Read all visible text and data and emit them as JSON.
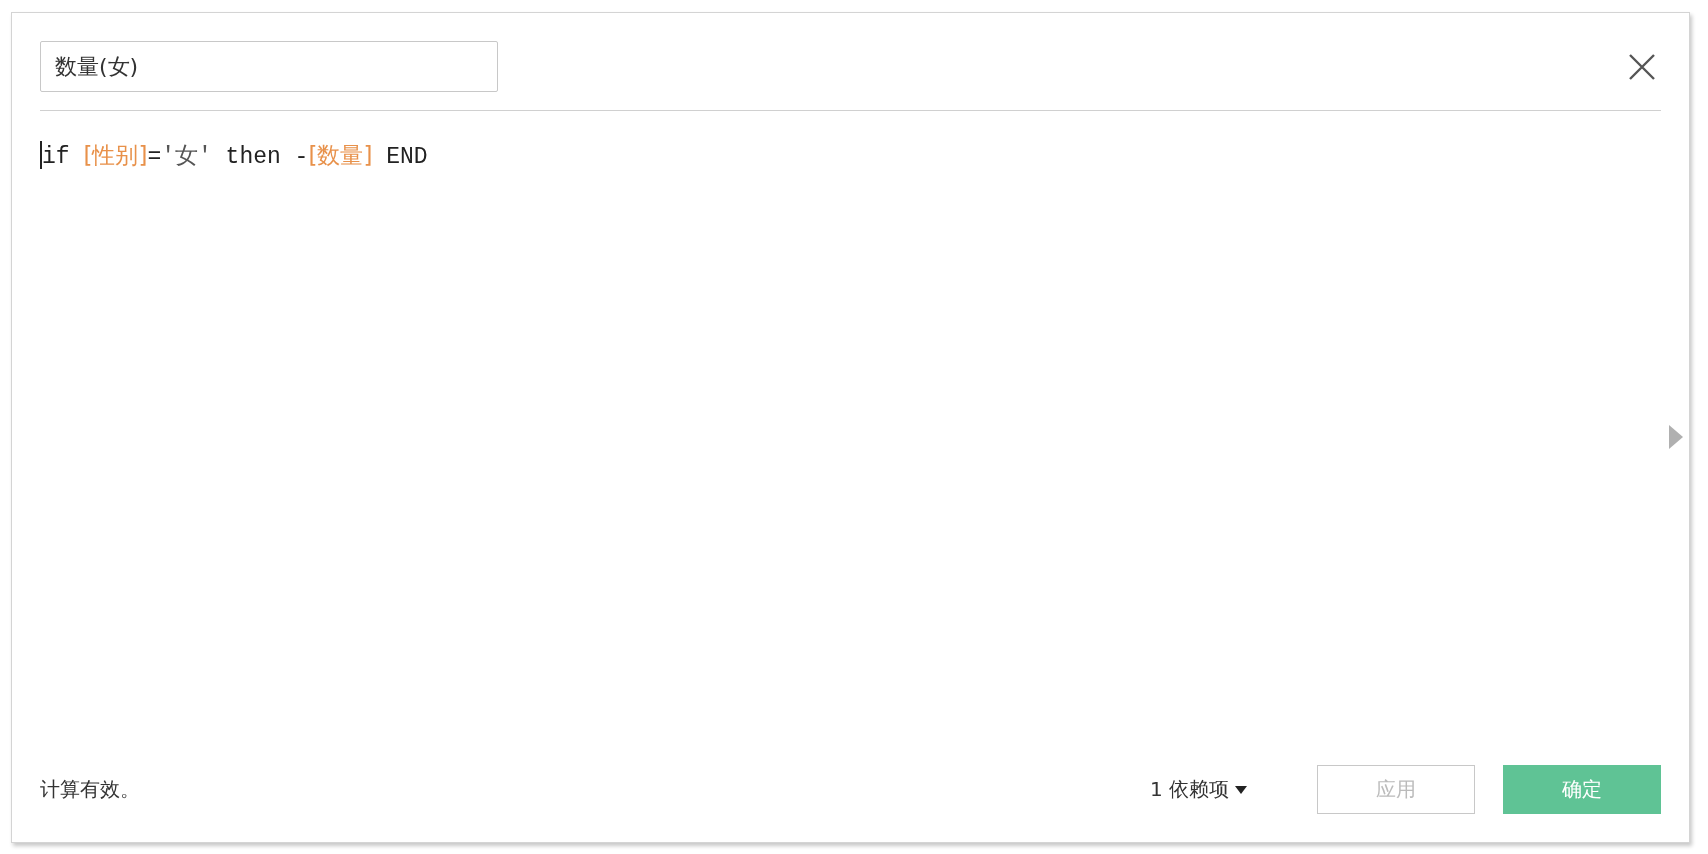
{
  "dialog": {
    "name_field": {
      "value": "数量(女)"
    },
    "formula": [
      {
        "kind": "plain",
        "text": "if "
      },
      {
        "kind": "field",
        "text": "[性别]"
      },
      {
        "kind": "plain",
        "text": "="
      },
      {
        "kind": "string",
        "text": "'女'"
      },
      {
        "kind": "plain",
        "text": " then -"
      },
      {
        "kind": "field",
        "text": "[数量]"
      },
      {
        "kind": "plain",
        "text": " END"
      }
    ],
    "status": "计算有效。",
    "dependencies": "1 依赖项",
    "buttons": [
      {
        "label": "应用",
        "kind": "secondary",
        "disabled": true
      },
      {
        "label": "确定",
        "kind": "primary",
        "disabled": false
      }
    ]
  }
}
